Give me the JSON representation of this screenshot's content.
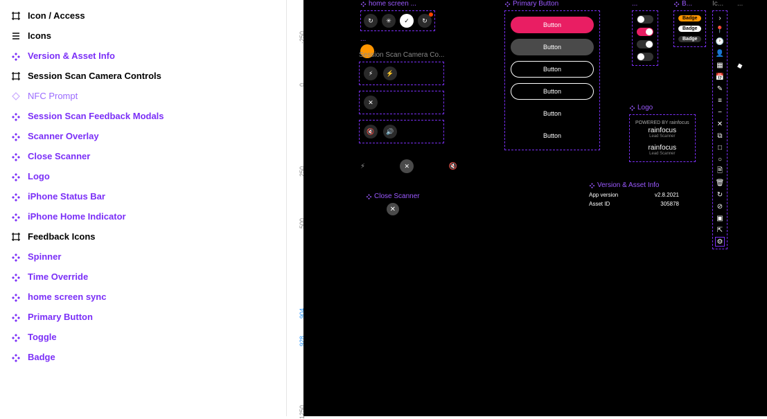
{
  "sidebar": {
    "items": [
      {
        "label": "Icon / Access",
        "type": "frame",
        "color": "black"
      },
      {
        "label": "Icons",
        "type": "list",
        "color": "black"
      },
      {
        "label": "Version & Asset Info",
        "type": "component",
        "color": "purple"
      },
      {
        "label": "Session Scan Camera Controls",
        "type": "frame",
        "color": "black"
      },
      {
        "label": "NFC Prompt",
        "type": "diamond",
        "color": "purple"
      },
      {
        "label": "Session Scan Feedback Modals",
        "type": "component",
        "color": "purple"
      },
      {
        "label": "Scanner Overlay",
        "type": "component",
        "color": "purple"
      },
      {
        "label": "Close Scanner",
        "type": "component",
        "color": "purple"
      },
      {
        "label": "Logo",
        "type": "component",
        "color": "purple"
      },
      {
        "label": "iPhone Status Bar",
        "type": "component",
        "color": "purple"
      },
      {
        "label": "iPhone Home Indicator",
        "type": "component",
        "color": "purple"
      },
      {
        "label": "Feedback Icons",
        "type": "frame",
        "color": "black"
      },
      {
        "label": "Spinner",
        "type": "component",
        "color": "purple"
      },
      {
        "label": "Time Override",
        "type": "component",
        "color": "purple"
      },
      {
        "label": "home screen sync",
        "type": "component",
        "color": "purple"
      },
      {
        "label": "Primary Button",
        "type": "component",
        "color": "purple"
      },
      {
        "label": "Toggle",
        "type": "component",
        "color": "purple"
      },
      {
        "label": "Badge",
        "type": "component",
        "color": "purple"
      }
    ]
  },
  "ruler": {
    "ticks": [
      {
        "label": "-250",
        "pos": 40
      },
      {
        "label": "0",
        "pos": 115
      },
      {
        "label": "250",
        "pos": 235
      },
      {
        "label": "500",
        "pos": 310
      },
      {
        "label": "904",
        "pos": 440,
        "blue": true
      },
      {
        "label": "928",
        "pos": 480,
        "blue": true
      },
      {
        "label": "1250",
        "pos": 580
      }
    ]
  },
  "canvas": {
    "home_screen": {
      "label": "home screen ...",
      "more": "..."
    },
    "sscc": {
      "label": "Session Scan Camera Co..."
    },
    "primary_button": {
      "label": "Primary Button",
      "buttons": [
        "Button",
        "Button",
        "Button",
        "Button",
        "Button",
        "Button"
      ]
    },
    "toggle": {
      "label": "..."
    },
    "badge": {
      "label": "B...",
      "items": [
        "Badge",
        "Badge",
        "Badge"
      ]
    },
    "icons": {
      "label": "Ic..."
    },
    "close_scanner": {
      "label": "Close Scanner"
    },
    "logo": {
      "label": "Logo",
      "powered": "POWERED BY rainfocus",
      "brand1": "rainfocus",
      "tag1": "Lead Scanner",
      "brand2": "rainfocus",
      "tag2": "Lead Scanner"
    },
    "version": {
      "label": "Version & Asset Info",
      "rows": [
        {
          "k": "App version",
          "v": "v2.8.2021"
        },
        {
          "k": "Asset ID",
          "v": "305878"
        }
      ]
    }
  }
}
